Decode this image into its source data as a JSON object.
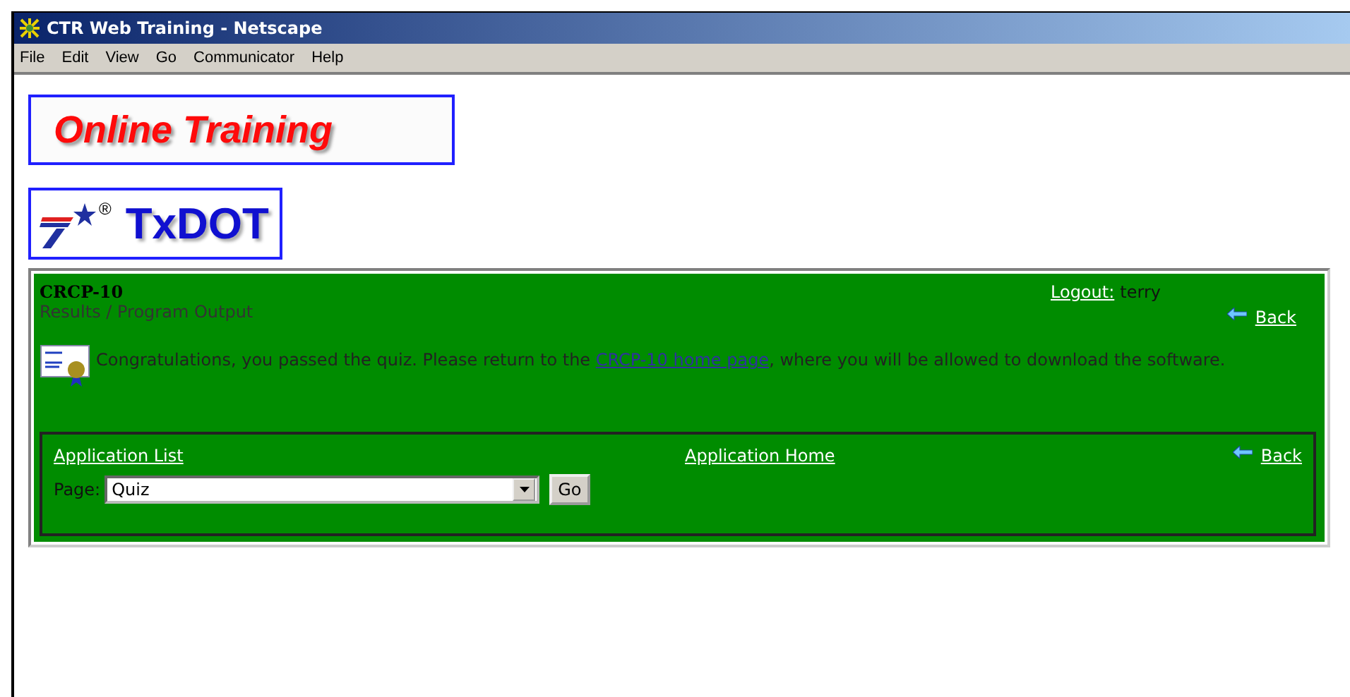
{
  "window": {
    "title": "CTR Web Training - Netscape"
  },
  "menu": [
    "File",
    "Edit",
    "View",
    "Go",
    "Communicator",
    "Help"
  ],
  "banner": {
    "title": "Online Training"
  },
  "logo": {
    "text": "TxDOT",
    "mark": "®"
  },
  "panel": {
    "course": "CRCP-10",
    "logout_link": "Logout:",
    "user": "terry",
    "subtitle": "Results / Program Output",
    "back": "Back",
    "message": {
      "before": "Congratulations, you passed the quiz. Please return to the ",
      "link": "CRCP-10 home page",
      "after": ", where you will be allowed to download the software."
    }
  },
  "nav": {
    "list_link": "Application List",
    "home_link": "Application Home",
    "back": "Back",
    "page_label": "Page:",
    "page_value": "Quiz",
    "go": "Go"
  }
}
